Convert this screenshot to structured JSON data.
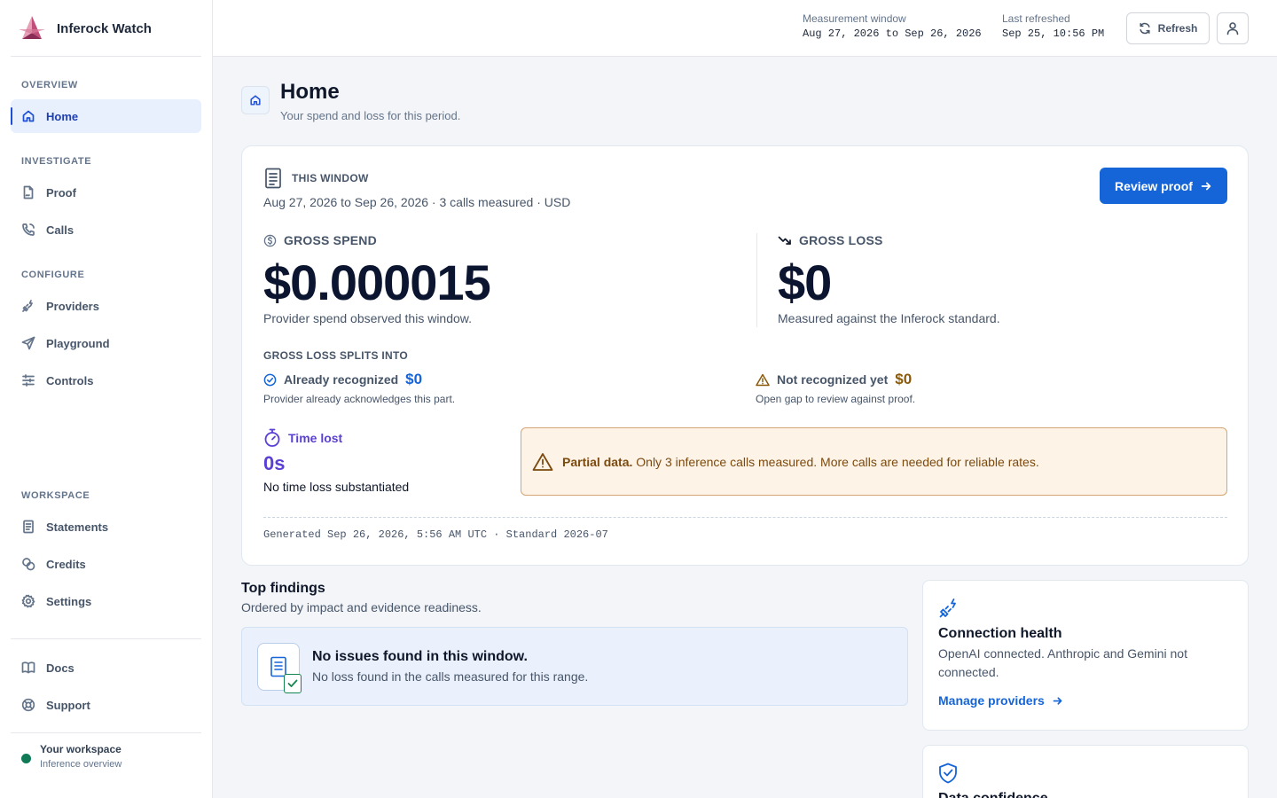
{
  "app": {
    "name": "Inferock Watch"
  },
  "sidebar": {
    "sections": {
      "overview": "OVERVIEW",
      "investigate": "INVESTIGATE",
      "configure": "CONFIGURE",
      "workspace": "WORKSPACE"
    },
    "items": {
      "home": "Home",
      "proof": "Proof",
      "calls": "Calls",
      "providers": "Providers",
      "playground": "Playground",
      "controls": "Controls",
      "statements": "Statements",
      "credits": "Credits",
      "settings": "Settings",
      "docs": "Docs",
      "support": "Support"
    },
    "active_item": "home",
    "workspace": {
      "title": "Your workspace",
      "subtitle": "Inference overview",
      "status_color": "#0f7a55"
    }
  },
  "topbar": {
    "measurement_label": "Measurement window",
    "measurement_value": "Aug 27, 2026 to Sep 26, 2026",
    "refreshed_label": "Last refreshed",
    "refreshed_value": "Sep 25, 10:56 PM",
    "refresh_button": "Refresh",
    "user_icon": "user-icon"
  },
  "page": {
    "title": "Home",
    "subtitle": "Your spend and loss for this period.",
    "icon": "home-icon"
  },
  "summary": {
    "window_label": "THIS WINDOW",
    "window_detail": "Aug 27, 2026 to Sep 26, 2026 · 3 calls measured · USD",
    "review_button": "Review proof",
    "gross_spend": {
      "label": "GROSS SPEND",
      "value": "$0.000015",
      "description": "Provider spend observed this window."
    },
    "gross_loss": {
      "label": "GROSS LOSS",
      "value": "$0",
      "description": "Measured against the Inferock standard."
    },
    "splits_heading": "GROSS LOSS SPLITS INTO",
    "already_recognized": {
      "label": "Already recognized",
      "value": "$0",
      "description": "Provider already acknowledges this part."
    },
    "not_recognized": {
      "label": "Not recognized yet",
      "value": "$0",
      "description": "Open gap to review against proof."
    },
    "time_lost": {
      "label": "Time lost",
      "value": "0s",
      "description": "No time loss substantiated"
    },
    "warning": {
      "title": "Partial data.",
      "text": "Only 3 inference calls measured. More calls are needed for reliable rates."
    },
    "generated": "Generated Sep 26, 2026, 5:56 AM UTC · Standard 2026-07"
  },
  "findings": {
    "title": "Top findings",
    "subtitle": "Ordered by impact and evidence readiness.",
    "empty_title": "No issues found in this window.",
    "empty_text": "No loss found in the calls measured for this range."
  },
  "connection_health": {
    "title": "Connection health",
    "text": "OpenAI connected. Anthropic and Gemini not connected.",
    "link": "Manage providers"
  },
  "data_confidence": {
    "title": "Data confidence"
  },
  "colors": {
    "accent": "#1565d8",
    "active_nav_bg": "#e8f0fe",
    "time_lost": "#5b3fd6",
    "not_recognized": "#8a5a0a",
    "warning_bg": "#fdf3e7",
    "success": "#14854f"
  }
}
